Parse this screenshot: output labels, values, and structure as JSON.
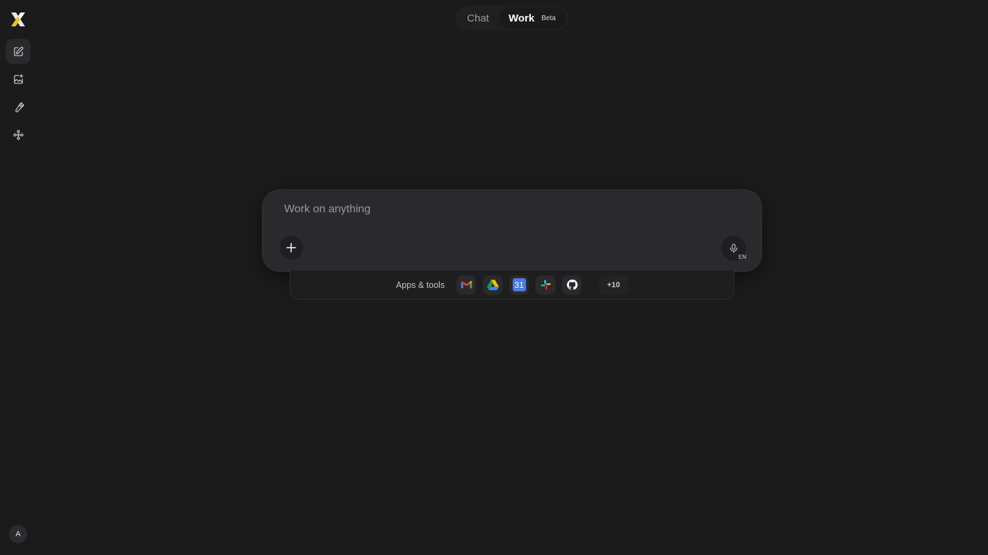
{
  "mode_toggle": {
    "chat_label": "Chat",
    "work_label": "Work",
    "beta_badge": "Beta"
  },
  "sidebar": {
    "items": [
      {
        "icon": "new-chat-icon"
      },
      {
        "icon": "image-edit-icon"
      },
      {
        "icon": "wrench-icon"
      },
      {
        "icon": "connectors-icon"
      }
    ],
    "avatar_initial": "A"
  },
  "composer": {
    "placeholder": "Work on anything",
    "mic_lang": "EN"
  },
  "apps_tray": {
    "label": "Apps & tools",
    "apps": [
      {
        "icon": "gmail-icon"
      },
      {
        "icon": "google-drive-icon"
      },
      {
        "icon": "google-calendar-icon",
        "text": "31"
      },
      {
        "icon": "slack-icon"
      },
      {
        "icon": "github-icon"
      }
    ],
    "more_label": "+10"
  },
  "colors": {
    "background": "#1b1b1b",
    "composer_bg": "#2a2a2c",
    "accent_calendar": "#4a7de0"
  }
}
